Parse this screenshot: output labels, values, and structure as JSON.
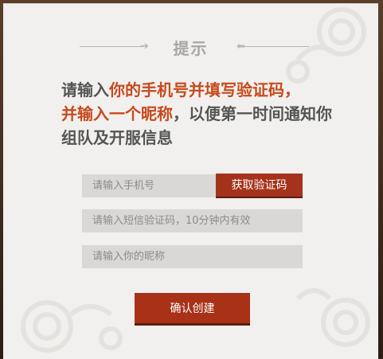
{
  "dialog": {
    "title": "提示",
    "message": {
      "part1": "请输入",
      "highlight1": "你的手机号并填写验证码，",
      "highlight2": "并输入一个昵称",
      "part2": "，以便第一时间通知你组队及开服信息"
    },
    "phone_placeholder": "请输入手机号",
    "get_code_label": "获取验证码",
    "code_placeholder": "请输入短信验证码，10分钟内有效",
    "nickname_placeholder": "请输入你的昵称",
    "confirm_label": "确认创建"
  },
  "colors": {
    "accent": "#c84a1c",
    "button": "#a5321a",
    "text": "#555555",
    "field_bg": "#d9d8d6",
    "dialog_bg": "#f1f0ee"
  },
  "icons": [
    "title-arrow-right-icon",
    "title-arrow-left-icon",
    "cloud-ornament-icon"
  ]
}
